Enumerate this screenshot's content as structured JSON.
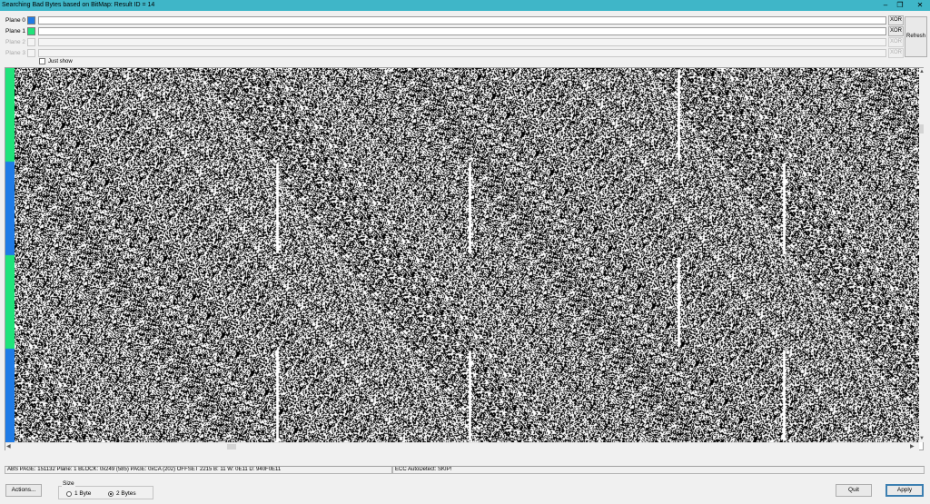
{
  "window": {
    "title": "Searching Bad Bytes based on BitMap: Result ID = 14",
    "minimize_glyph": "–",
    "restore_glyph": "❐",
    "close_glyph": "✕"
  },
  "planes": [
    {
      "label": "Plane 0",
      "color": "#1f7be6",
      "enabled": true,
      "xor_label": "XOR"
    },
    {
      "label": "Plane 1",
      "color": "#1fe37a",
      "enabled": true,
      "xor_label": "XOR"
    },
    {
      "label": "Plane 2",
      "color": "#f4f4f4",
      "enabled": false,
      "xor_label": "XOR"
    },
    {
      "label": "Plane 3",
      "color": "#f4f4f4",
      "enabled": false,
      "xor_label": "XOR"
    }
  ],
  "refresh_label": "Refresh",
  "just_show_label": "Just show",
  "bitmap": {
    "plane_strip": [
      "plane-1",
      "plane-0",
      "plane-1",
      "plane-0"
    ],
    "colors": {
      "plane-0": "#1f7be6",
      "plane-1": "#1fe37a"
    }
  },
  "status": {
    "left": "ABS PAGE: 151132   Plane: 1   BLOCK: 0x249 (585)   PAGE: 0xCA (202)   OFFSET 2215      B: 11 W: 0E11 D: 940F0E11",
    "right": "ECC AutoDetect: SKIP!"
  },
  "buttons": {
    "actions": "Actions...",
    "quit": "Quit",
    "apply": "Apply"
  },
  "size_group": {
    "title": "Size",
    "options": [
      "1 Byte",
      "2 Bytes"
    ],
    "selected": "2 Bytes"
  },
  "icons": {
    "up": "▲",
    "down": "▼",
    "left": "◀",
    "right": "▶"
  }
}
